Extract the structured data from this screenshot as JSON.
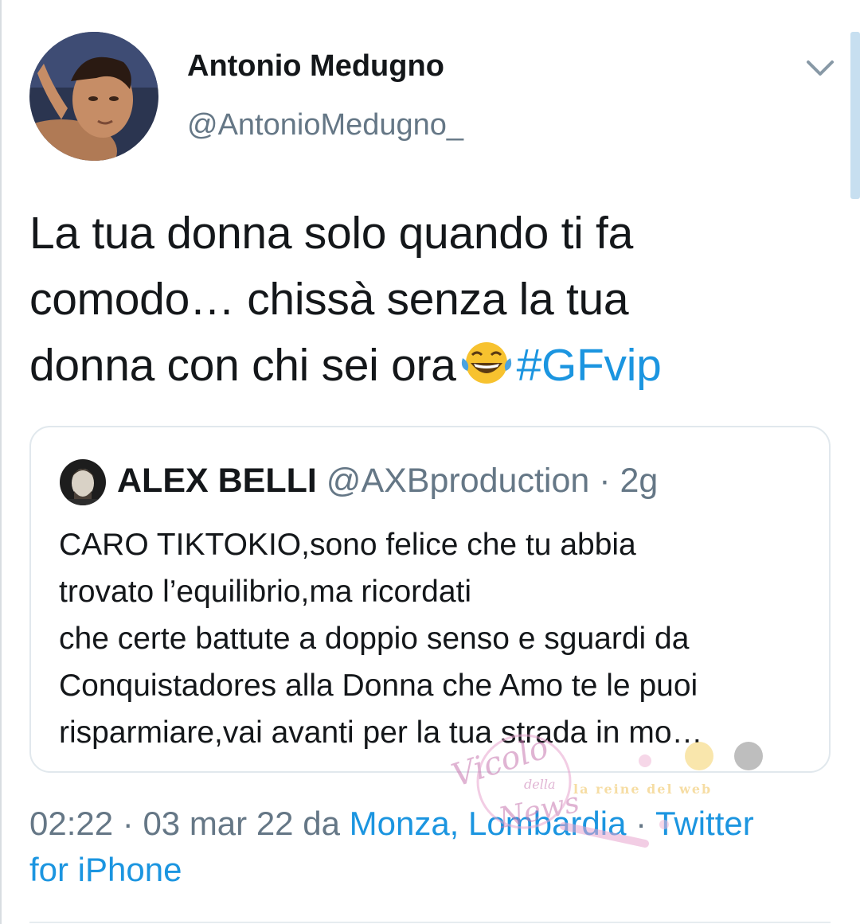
{
  "tweet": {
    "author_name": "Antonio Medugno",
    "author_handle": "@AntonioMedugno_",
    "text_lines": [
      "La tua donna solo quando ti fa",
      "comodo… chissà senza la tua",
      "donna con chi sei ora"
    ],
    "emoji": "face-with-tears-of-joy",
    "hashtag": "#GFvip",
    "menu_icon": "chevron-down-icon"
  },
  "quoted_tweet": {
    "author_name": "ALEX BELLI",
    "author_handle": "@AXBproduction",
    "separator": " · ",
    "age": "2g",
    "text_lines": [
      "CARO TIKTOKIO,sono felice che tu abbia",
      "trovato l’equilibrio,ma ricordati",
      "che certe battute a doppio senso e sguardi da",
      "Conquistadores alla Donna che Amo te le puoi",
      "risparmiare,vai avanti per la tua strada in mo…"
    ]
  },
  "meta": {
    "time": "02:22",
    "separator": " · ",
    "date": "03 mar 22",
    "from_word": "da",
    "location": "Monza, Lombardia",
    "source": "Twitter",
    "source_line2": "for iPhone"
  },
  "watermark": {
    "primary": "Vicolo",
    "secondary": "della",
    "tertiary": "News",
    "tagline": "la reine del web"
  },
  "colors": {
    "link": "#1b95e0",
    "secondary_text": "#657786",
    "primary_text": "#14171a",
    "border": "#e1e8ed"
  }
}
